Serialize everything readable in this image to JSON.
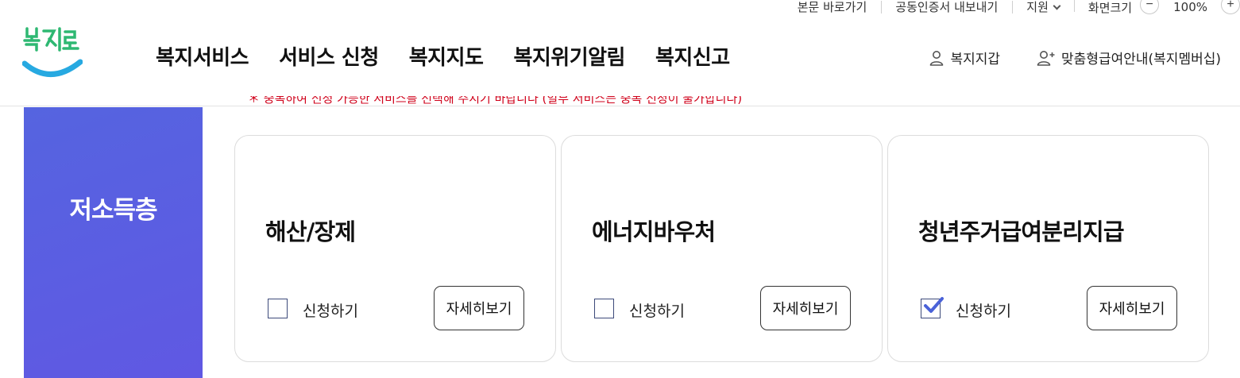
{
  "utility": {
    "skip_link": "본문 바로가기",
    "cert_export": "공동인증서 내보내기",
    "support": "지원",
    "zoom_label": "화면크기",
    "zoom_minus": "−",
    "zoom_value": "100%",
    "zoom_plus": "+"
  },
  "logo": {
    "text": "복지로"
  },
  "nav": {
    "items": [
      "복지서비스",
      "서비스 신청",
      "복지지도",
      "복지위기알림",
      "복지신고"
    ]
  },
  "header_right": {
    "wallet": "복지지갑",
    "membership": "맞춤형급여안내(복지멤버십)"
  },
  "notice": {
    "text": "＊ 중복하여 신청 가능한 서비스를 선택해 주시기 바랍니다 (일부 서비스는 중복 신청이 불가합니다)"
  },
  "side": {
    "title": "저소득층"
  },
  "cards": [
    {
      "title": "해산/장제",
      "apply_label": "신청하기",
      "detail_label": "자세히보기",
      "checked": false
    },
    {
      "title": "에너지바우처",
      "apply_label": "신청하기",
      "detail_label": "자세히보기",
      "checked": false
    },
    {
      "title": "청년주거급여분리지급",
      "apply_label": "신청하기",
      "detail_label": "자세히보기",
      "checked": true
    }
  ],
  "colors": {
    "side_banner": "#5a5fe2",
    "notice": "#d0021b",
    "logo_green": "#2eb872",
    "logo_blue": "#27a9e1",
    "checkmark": "#4a62d8"
  },
  "icons": {
    "wallet": "person-icon",
    "membership": "person-plus-icon",
    "support": "chevron-down-icon",
    "checkbox_checked": "checkmark-icon"
  }
}
